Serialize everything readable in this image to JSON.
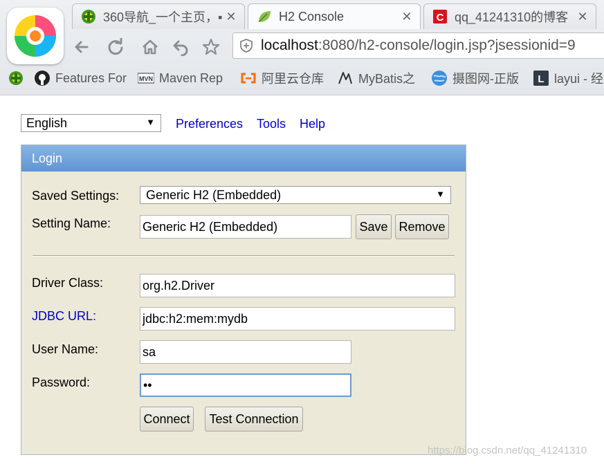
{
  "browser": {
    "tabs": [
      {
        "title": "360导航_一个主页，▪",
        "icon": "360-nav-icon",
        "active": false
      },
      {
        "title": "H2 Console",
        "icon": "leaf-icon",
        "active": true
      },
      {
        "title": "qq_41241310的博客",
        "icon": "csdn-icon",
        "active": false
      }
    ],
    "close_glyph": "✕",
    "url": {
      "host": "localhost",
      "path": ":8080/h2-console/login.jsp?jsessionid=9"
    },
    "bookmarks": [
      {
        "label": "Features For",
        "icon": "github-icon"
      },
      {
        "label": "Maven Rep",
        "icon": "maven-icon"
      },
      {
        "label": "阿里云仓库",
        "icon": "aliyun-icon"
      },
      {
        "label": "MyBatis之",
        "icon": "mybatis-icon"
      },
      {
        "label": "摄图网-正版",
        "icon": "globe-icon"
      },
      {
        "label": "layui - 经",
        "icon": "layui-icon"
      }
    ]
  },
  "top_bar": {
    "language": "English",
    "links": {
      "preferences": "Preferences",
      "tools": "Tools",
      "help": "Help"
    }
  },
  "login": {
    "header": "Login",
    "saved_settings_label": "Saved Settings:",
    "saved_settings_value": "Generic H2 (Embedded)",
    "setting_name_label": "Setting Name:",
    "setting_name_value": "Generic H2 (Embedded)",
    "save_button": "Save",
    "remove_button": "Remove",
    "driver_class_label": "Driver Class:",
    "driver_class_value": "org.h2.Driver",
    "jdbc_url_label": "JDBC URL:",
    "jdbc_url_value": "jdbc:h2:mem:mydb",
    "user_name_label": "User Name:",
    "user_name_value": "sa",
    "password_label": "Password:",
    "password_value": "••",
    "connect_button": "Connect",
    "test_connection_button": "Test Connection"
  },
  "watermark": "https://blog.csdn.net/qq_41241310",
  "colors": {
    "link": "#0000cc",
    "panel_bg": "#ece9d8",
    "header_top": "#86b4e4",
    "header_bottom": "#5f95d3"
  }
}
